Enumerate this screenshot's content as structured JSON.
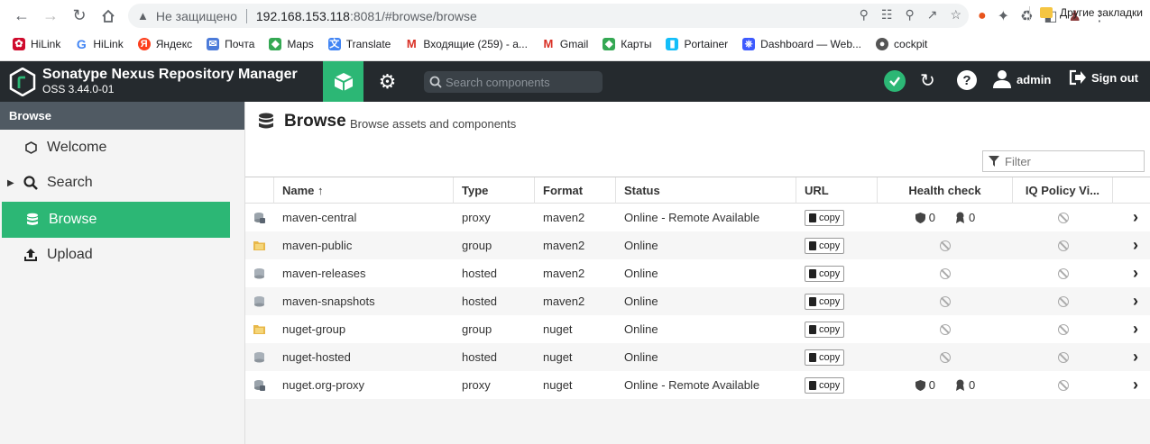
{
  "browser": {
    "insecure_label": "Не защищено",
    "url_host": "192.168.153.118",
    "url_rest": ":8081/#browse/browse",
    "bookmarks": [
      {
        "label": "HiLink",
        "icon": "huawei-icon",
        "color": "#cf0a2c"
      },
      {
        "label": "HiLink",
        "icon": "google-icon",
        "color": "#4285f4"
      },
      {
        "label": "Яндекс",
        "icon": "yandex-icon",
        "color": "#fc3f1d"
      },
      {
        "label": "Почта",
        "icon": "mail-icon",
        "color": "#4c7bd9"
      },
      {
        "label": "Maps",
        "icon": "maps-icon",
        "color": "#34a853"
      },
      {
        "label": "Translate",
        "icon": "translate-icon",
        "color": "#4285f4"
      },
      {
        "label": "Входящие (259) - a...",
        "icon": "gmail-icon",
        "color": "#d93025"
      },
      {
        "label": "Gmail",
        "icon": "gmail-icon",
        "color": "#d93025"
      },
      {
        "label": "Карты",
        "icon": "maps-icon",
        "color": "#34a853"
      },
      {
        "label": "Portainer",
        "icon": "portainer-icon",
        "color": "#13bef9"
      },
      {
        "label": "Dashboard — Web...",
        "icon": "dashboard-icon",
        "color": "#3d5afe"
      },
      {
        "label": "cockpit",
        "icon": "cockpit-icon",
        "color": "#555555"
      }
    ],
    "other_bookmarks": "Другие закладки"
  },
  "header": {
    "title": "Sonatype Nexus Repository Manager",
    "version": "OSS 3.44.0-01",
    "search_placeholder": "Search components",
    "user": "admin",
    "signout": "Sign out",
    "accent": "#2cb775"
  },
  "sidebar": {
    "section": "Browse",
    "items": [
      {
        "label": "Welcome",
        "icon": "hexagon-icon"
      },
      {
        "label": "Search",
        "icon": "search-icon"
      },
      {
        "label": "Browse",
        "icon": "database-icon",
        "active": true
      },
      {
        "label": "Upload",
        "icon": "upload-icon"
      }
    ]
  },
  "page": {
    "title": "Browse",
    "subtitle": "Browse assets and components",
    "filter_placeholder": "Filter"
  },
  "table": {
    "columns": [
      "Name ↑",
      "Type",
      "Format",
      "Status",
      "URL",
      "Health check",
      "IQ Policy Vi..."
    ],
    "copy_label": "copy",
    "rows": [
      {
        "name": "maven-central",
        "type": "proxy",
        "format": "maven2",
        "status": "Online - Remote Available",
        "icon": "proxy-repo-icon",
        "health": [
          "0",
          "0"
        ]
      },
      {
        "name": "maven-public",
        "type": "group",
        "format": "maven2",
        "status": "Online",
        "icon": "group-repo-icon",
        "health": null
      },
      {
        "name": "maven-releases",
        "type": "hosted",
        "format": "maven2",
        "status": "Online",
        "icon": "hosted-repo-icon",
        "health": null
      },
      {
        "name": "maven-snapshots",
        "type": "hosted",
        "format": "maven2",
        "status": "Online",
        "icon": "hosted-repo-icon",
        "health": null
      },
      {
        "name": "nuget-group",
        "type": "group",
        "format": "nuget",
        "status": "Online",
        "icon": "group-repo-icon",
        "health": null
      },
      {
        "name": "nuget-hosted",
        "type": "hosted",
        "format": "nuget",
        "status": "Online",
        "icon": "hosted-repo-icon",
        "health": null
      },
      {
        "name": "nuget.org-proxy",
        "type": "proxy",
        "format": "nuget",
        "status": "Online - Remote Available",
        "icon": "proxy-repo-icon",
        "health": [
          "0",
          "0"
        ]
      }
    ]
  }
}
